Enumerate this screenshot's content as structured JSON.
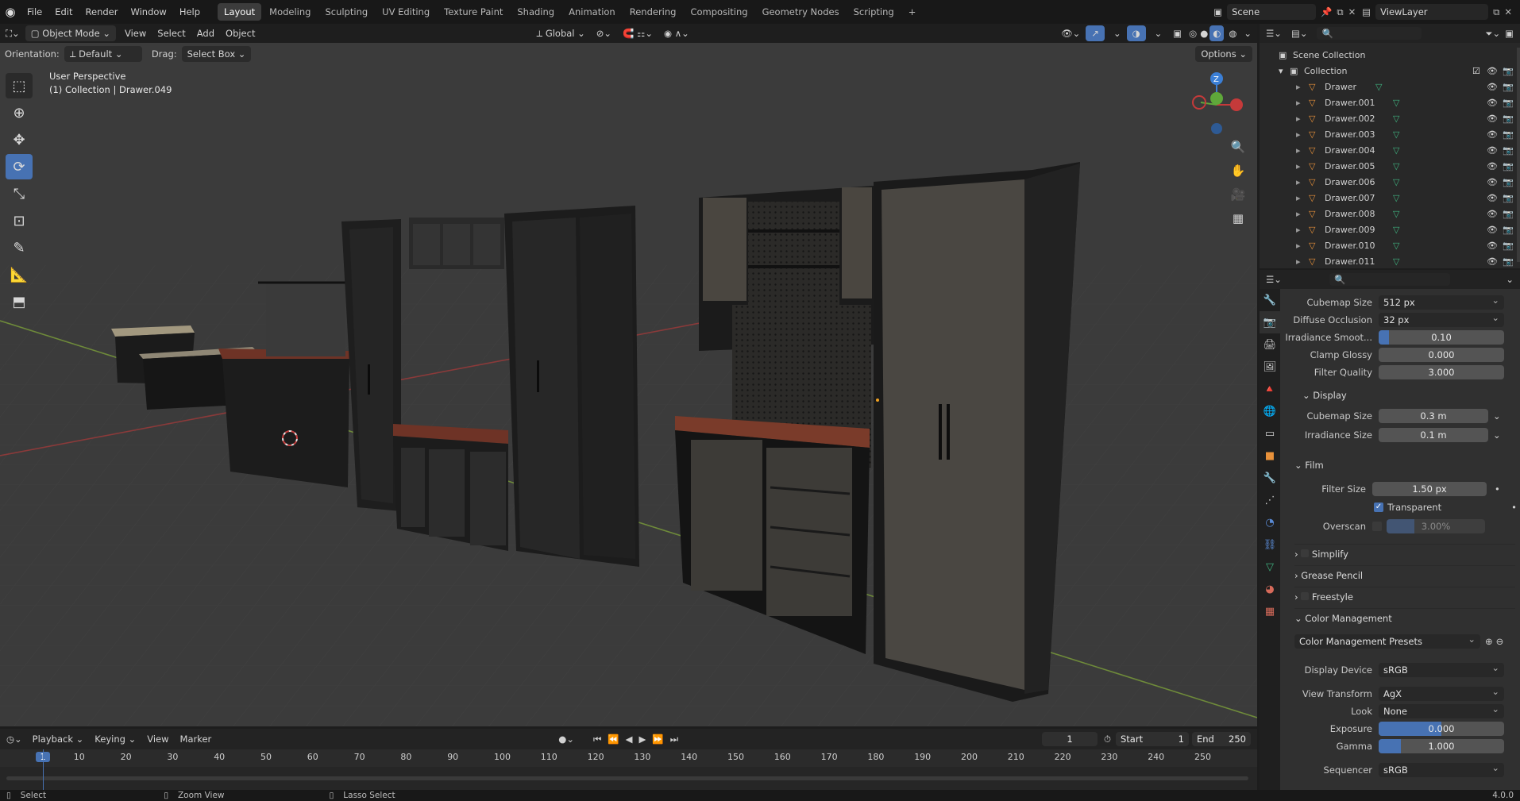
{
  "topbar": {
    "menus": [
      "File",
      "Edit",
      "Render",
      "Window",
      "Help"
    ],
    "workspaces": [
      "Layout",
      "Modeling",
      "Sculpting",
      "UV Editing",
      "Texture Paint",
      "Shading",
      "Animation",
      "Rendering",
      "Compositing",
      "Geometry Nodes",
      "Scripting"
    ],
    "active_workspace": "Layout",
    "add_tab": "+",
    "scene": "Scene",
    "view_layer": "ViewLayer"
  },
  "viewport_header": {
    "mode": "Object Mode",
    "menus": [
      "View",
      "Select",
      "Add",
      "Object"
    ],
    "transform_orientation": "Global",
    "options": "Options"
  },
  "tool_settings": {
    "orientation_label": "Orientation:",
    "orientation_value": "Default",
    "drag_label": "Drag:",
    "drag_value": "Select Box"
  },
  "viewport": {
    "perspective": "User Perspective",
    "collection_info": "(1) Collection | Drawer.049",
    "gizmo_axes": {
      "z": "Z",
      "y": "Y",
      "x": "X"
    }
  },
  "outliner": {
    "scene_collection": "Scene Collection",
    "collection": "Collection",
    "items": [
      "Drawer",
      "Drawer.001",
      "Drawer.002",
      "Drawer.003",
      "Drawer.004",
      "Drawer.005",
      "Drawer.006",
      "Drawer.007",
      "Drawer.008",
      "Drawer.009",
      "Drawer.010",
      "Drawer.011"
    ]
  },
  "properties": {
    "cubemap_size": {
      "label": "Cubemap Size",
      "value": "512 px"
    },
    "diffuse_occlusion": {
      "label": "Diffuse Occlusion",
      "value": "32 px"
    },
    "irradiance_smooth": {
      "label": "Irradiance Smoot...",
      "value": "0.10",
      "fraction": 0.08
    },
    "clamp_glossy": {
      "label": "Clamp Glossy",
      "value": "0.000"
    },
    "filter_quality": {
      "label": "Filter Quality",
      "value": "3.000"
    },
    "display_section": "Display",
    "display_cubemap": {
      "label": "Cubemap Size",
      "value": "0.3 m"
    },
    "display_irradiance": {
      "label": "Irradiance Size",
      "value": "0.1 m"
    },
    "film_section": "Film",
    "filter_size": {
      "label": "Filter Size",
      "value": "1.50 px"
    },
    "transparent": {
      "label": "Transparent",
      "checked": true
    },
    "overscan": {
      "label": "Overscan",
      "value": "3.00%",
      "checked": false
    },
    "simplify": "Simplify",
    "grease_pencil": "Grease Pencil",
    "freestyle": "Freestyle",
    "color_management": "Color Management",
    "cm_presets": "Color Management Presets",
    "display_device": {
      "label": "Display Device",
      "value": "sRGB"
    },
    "view_transform": {
      "label": "View Transform",
      "value": "AgX"
    },
    "look": {
      "label": "Look",
      "value": "None"
    },
    "exposure": {
      "label": "Exposure",
      "value": "0.000",
      "fraction": 0.5
    },
    "gamma": {
      "label": "Gamma",
      "value": "1.000",
      "fraction": 0.18
    },
    "sequencer": {
      "label": "Sequencer",
      "value": "sRGB"
    }
  },
  "timeline": {
    "menus": [
      "Playback",
      "Keying",
      "View",
      "Marker"
    ],
    "current_frame": "1",
    "start_label": "Start",
    "start_value": "1",
    "end_label": "End",
    "end_value": "250",
    "ruler": [
      "1",
      "10",
      "20",
      "30",
      "40",
      "50",
      "60",
      "70",
      "80",
      "90",
      "100",
      "110",
      "120",
      "130",
      "140",
      "150",
      "160",
      "170",
      "180",
      "190",
      "200",
      "210",
      "220",
      "230",
      "240",
      "250"
    ]
  },
  "statusbar": {
    "select": "Select",
    "zoom": "Zoom View",
    "lasso": "Lasso Select",
    "version": "4.0.0"
  },
  "colors": {
    "accent": "#4772b3",
    "active_frame": "#4772b3",
    "mesh_icon": "#e8913a",
    "vertex_icon": "#3fb27f"
  }
}
